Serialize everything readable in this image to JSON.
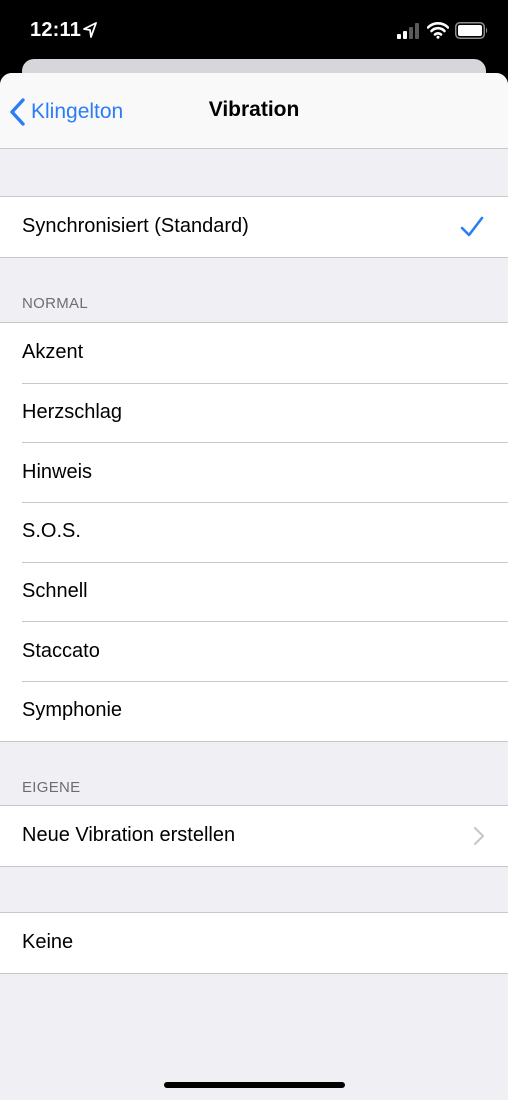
{
  "status_bar": {
    "time": "12:11",
    "icons": [
      "location-icon",
      "signal-icon",
      "wifi-icon",
      "battery-icon"
    ]
  },
  "nav": {
    "back_label": "Klingelton",
    "title": "Vibration"
  },
  "default_option": {
    "label": "Synchronisiert (Standard)",
    "selected": true
  },
  "normal": {
    "header": "NORMAL",
    "items": [
      "Akzent",
      "Herzschlag",
      "Hinweis",
      "S.O.S.",
      "Schnell",
      "Staccato",
      "Symphonie"
    ]
  },
  "custom": {
    "header": "EIGENE",
    "create_label": "Neue Vibration erstellen"
  },
  "none_option": {
    "label": "Keine"
  },
  "colors": {
    "accent": "#2a7df6",
    "background": "#efeff4",
    "separator": "#c8c7cc",
    "section_header": "#6d6d72"
  }
}
